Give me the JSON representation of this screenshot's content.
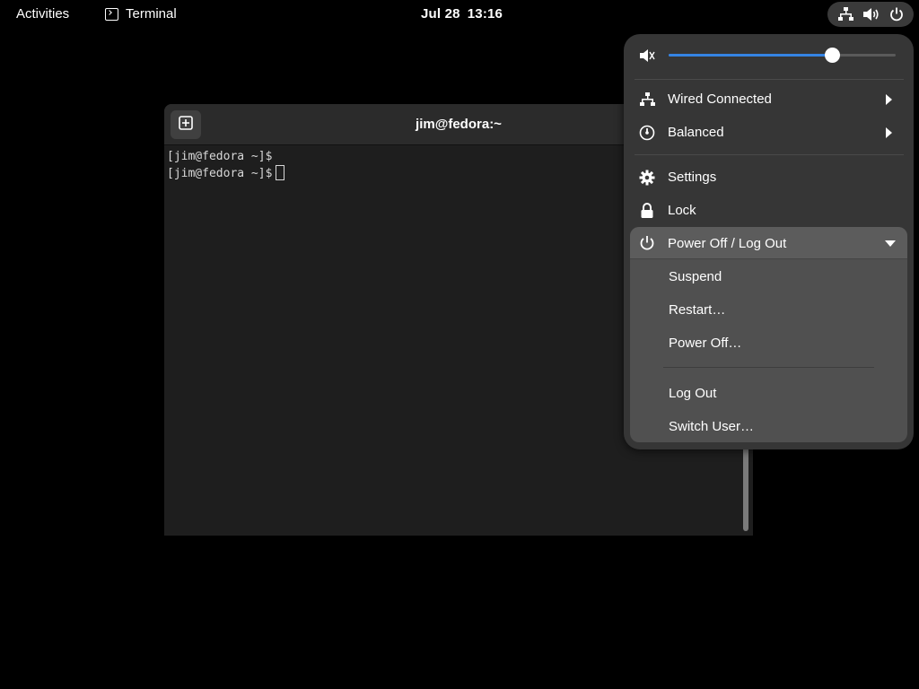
{
  "topbar": {
    "activities_label": "Activities",
    "app_name": "Terminal",
    "date": "Jul 28",
    "time": "13:16"
  },
  "terminal": {
    "title": "jim@fedora:~",
    "lines": [
      "[jim@fedora ~]$",
      "[jim@fedora ~]$"
    ]
  },
  "quick_settings": {
    "volume_fraction": 0.72,
    "accent_color": "#3584e4",
    "network_label": "Wired Connected",
    "power_mode_label": "Balanced",
    "settings_label": "Settings",
    "lock_label": "Lock",
    "power_menu": {
      "title": "Power Off / Log Out",
      "items": [
        "Suspend",
        "Restart…",
        "Power Off…"
      ],
      "session_items": [
        "Log Out",
        "Switch User…"
      ]
    }
  },
  "icons": [
    "terminal-icon",
    "network-wired-icon",
    "volume-icon",
    "power-icon",
    "volume-muted-icon",
    "power-mode-icon",
    "gear-icon",
    "lock-icon",
    "new-tab-icon"
  ]
}
